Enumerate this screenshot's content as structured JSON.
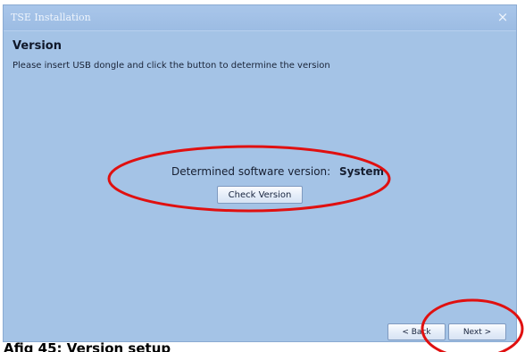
{
  "window": {
    "title": "TSE Installation",
    "close_glyph": "×"
  },
  "page": {
    "heading": "Version",
    "instruction": "Please insert USB dongle and click the button to determine the version"
  },
  "version": {
    "label": "Determined software version:",
    "value": "System",
    "check_button_label": "Check Version"
  },
  "navigation": {
    "back_label": "< Back",
    "next_label": "Next >"
  },
  "caption": "Afig 45: Version setup",
  "colors": {
    "dialog_background": "#a4c3e6",
    "annotation_red": "#e01010"
  }
}
